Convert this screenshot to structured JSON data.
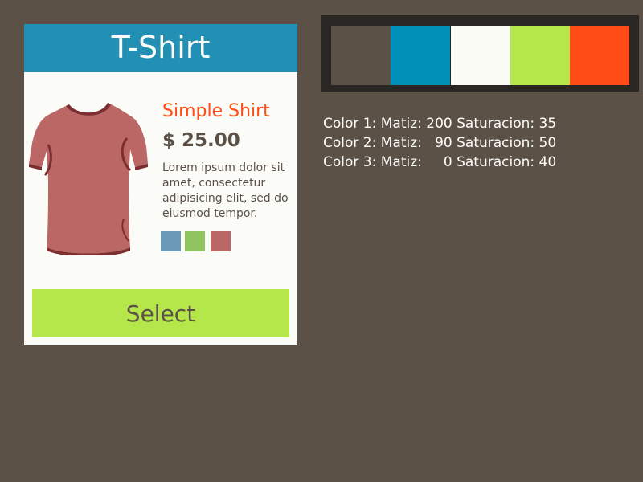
{
  "card": {
    "header_title": "T-Shirt",
    "product_name": "Simple Shirt",
    "price": "$ 25.00",
    "description": "Lorem ipsum dolor sit amet, consectetur adipisicing elit, sed do eiusmod tempor.",
    "select_label": "Select",
    "swatches": [
      {
        "color": "#6a9ab7"
      },
      {
        "color": "#8ec35f"
      },
      {
        "color": "#bb6766"
      }
    ]
  },
  "palette": [
    {
      "color": "#5b5147"
    },
    {
      "color": "#0090b7"
    },
    {
      "color": "#fbfbf6"
    },
    {
      "color": "#b5e64a"
    },
    {
      "color": "#ff4c17"
    }
  ],
  "color_info": {
    "lines": [
      "Color 1: Matiz: 200 Saturacion: 35",
      "Color 2: Matiz:   90 Saturacion: 50",
      "Color 3: Matiz:     0 Saturacion: 40"
    ]
  },
  "colors": {
    "background": "#5b5147",
    "header": "#2190b4",
    "accent": "#ff4d15",
    "button": "#b5e64a",
    "shirt": "#bb6766"
  }
}
